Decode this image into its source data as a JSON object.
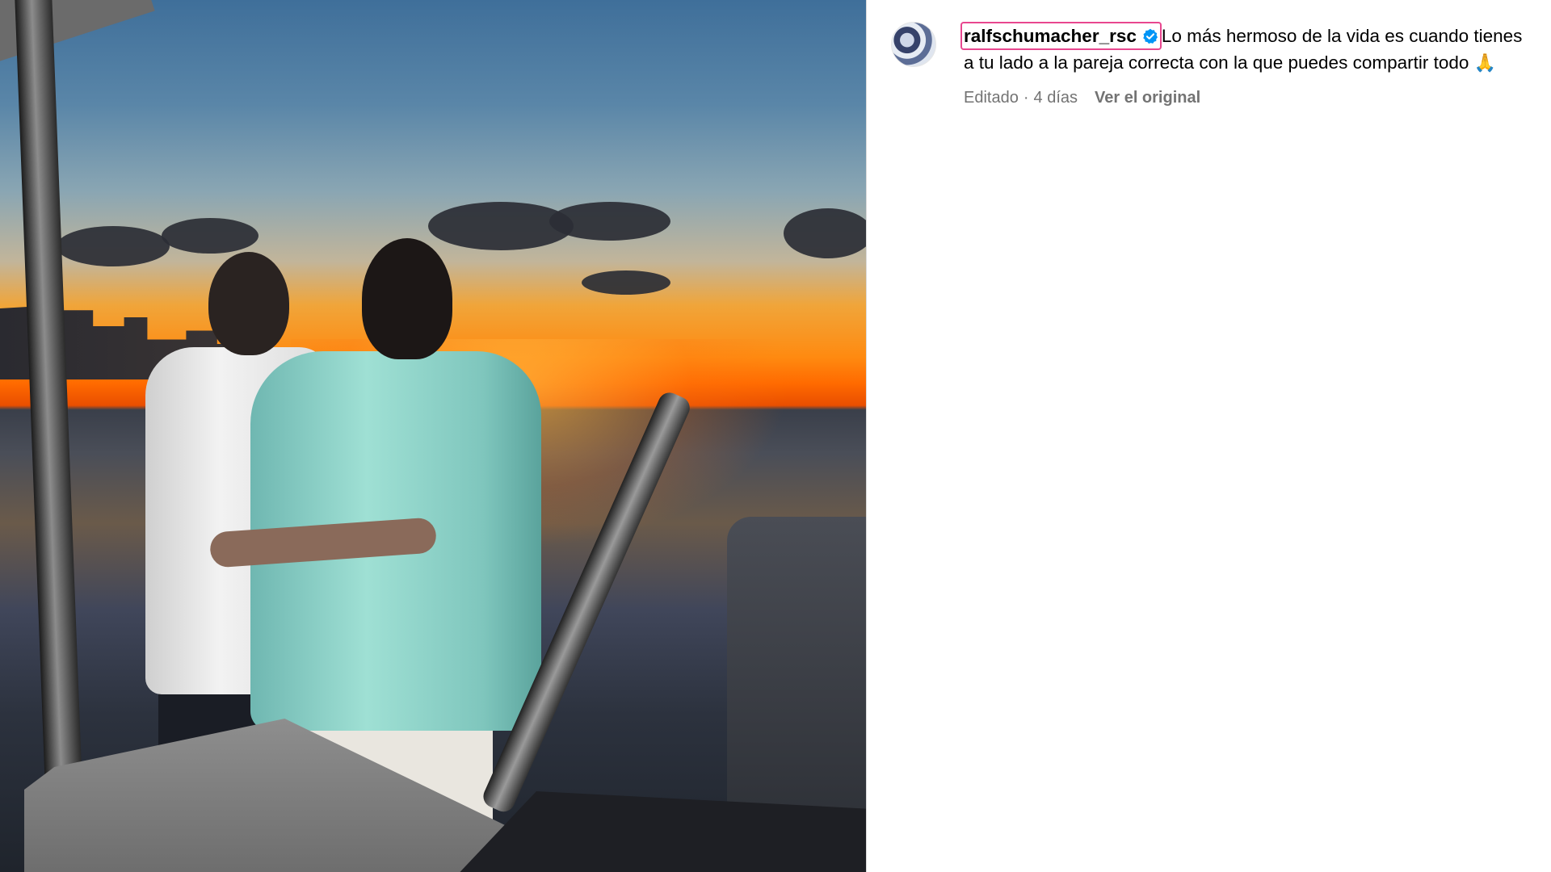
{
  "post": {
    "image_alt_icon": "photo-sunset-boat"
  },
  "comment": {
    "username": "ralfschumacher_rsc",
    "verified_icon": "verified-badge-icon",
    "caption": "Lo más hermoso de la vida es cuando tienes a tu lado a la pareja correcta con la que puedes compartir todo",
    "emoji": "🙏",
    "edited_label": "Editado",
    "separator": "·",
    "age": "4 días",
    "see_original_label": "Ver el original"
  },
  "colors": {
    "highlight_border": "#e8478f",
    "verified_blue": "#0095f6",
    "meta_gray": "#737373",
    "divider": "#dbdbdb"
  }
}
